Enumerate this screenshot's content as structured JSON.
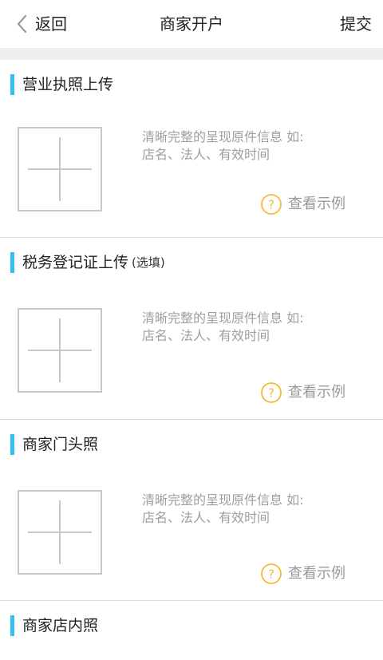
{
  "header": {
    "back_label": "返回",
    "title": "商家开户",
    "submit_label": "提交"
  },
  "colors": {
    "accent": "#35bff1",
    "help_icon": "#f5b938",
    "hint_text": "#9e9e9e"
  },
  "sections": [
    {
      "title": "营业执照上传",
      "optional": "",
      "hint_line1": "清晰完整的呈现原件信息 如:",
      "hint_line2": "店名、法人、有效时间",
      "example_label": "查看示例",
      "icon": "question-circle-icon"
    },
    {
      "title": "税务登记证上传",
      "optional": "(选填)",
      "hint_line1": "清晰完整的呈现原件信息 如:",
      "hint_line2": "店名、法人、有效时间",
      "example_label": "查看示例",
      "icon": "question-circle-icon"
    },
    {
      "title": "商家门头照",
      "optional": "",
      "hint_line1": "清晰完整的呈现原件信息 如:",
      "hint_line2": "店名、法人、有效时间",
      "example_label": "查看示例",
      "icon": "question-circle-icon"
    },
    {
      "title": "商家店内照",
      "optional": ""
    }
  ]
}
